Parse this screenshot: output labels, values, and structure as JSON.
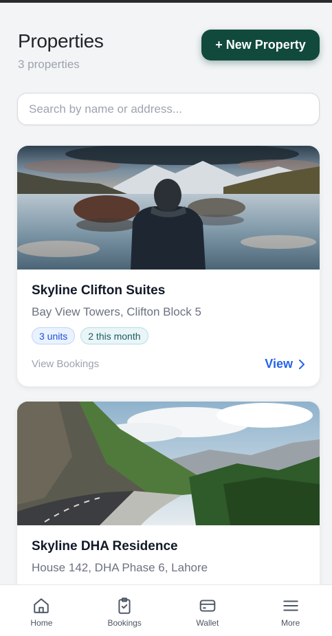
{
  "header": {
    "title": "Properties",
    "subtitle": "3 properties",
    "new_button": "+ New Property"
  },
  "search": {
    "placeholder": "Search by name or address..."
  },
  "properties": [
    {
      "name": "Skyline Clifton Suites",
      "address": "Bay View Towers, Clifton Block 5",
      "units_badge": "3 units",
      "bookings_badge": "2 this month",
      "view_bookings": "View Bookings",
      "view": "View"
    },
    {
      "name": "Skyline DHA Residence",
      "address": "House 142, DHA Phase 6, Lahore"
    }
  ],
  "bottom_nav": [
    {
      "label": "Home",
      "icon": "home-icon"
    },
    {
      "label": "Bookings",
      "icon": "clipboard-check-icon"
    },
    {
      "label": "Wallet",
      "icon": "wallet-icon"
    },
    {
      "label": "More",
      "icon": "menu-icon"
    }
  ],
  "colors": {
    "primary": "#114a3c",
    "link": "#2563eb",
    "background": "#f3f4f6"
  }
}
